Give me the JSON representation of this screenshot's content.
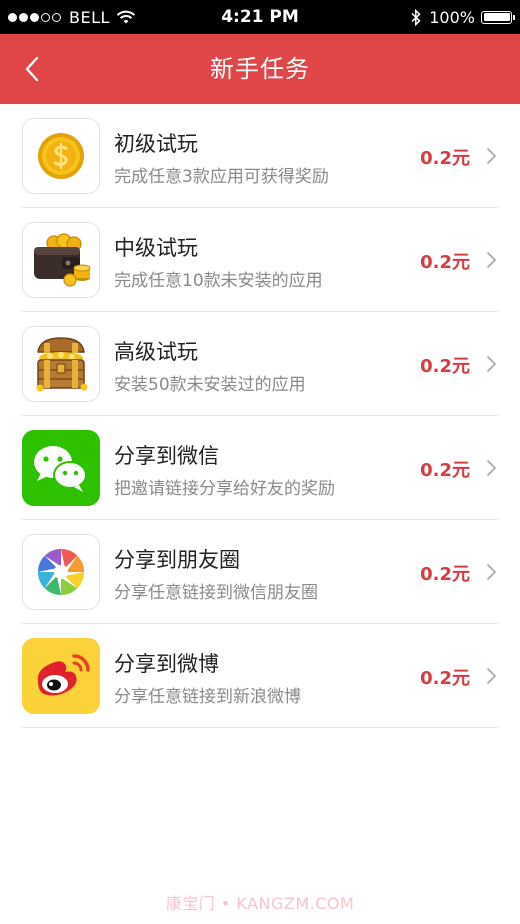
{
  "status_bar": {
    "carrier": "BELL",
    "time": "4:21 PM",
    "battery": "100%",
    "signal_icon": "signal-dots-icon",
    "wifi_icon": "wifi-icon",
    "bluetooth_icon": "bluetooth-icon",
    "battery_icon": "battery-icon"
  },
  "nav": {
    "title": "新手任务",
    "back_icon": "chevron-left-icon",
    "color": "#e04548"
  },
  "tasks": [
    {
      "title": "初级试玩",
      "desc": "完成任意3款应用可获得奖励",
      "reward": "0.2元",
      "icon": "gold-coin-icon"
    },
    {
      "title": "中级试玩",
      "desc": "完成任意10款未安装的应用",
      "reward": "0.2元",
      "icon": "wallet-coins-icon"
    },
    {
      "title": "高级试玩",
      "desc": "安装50款未安装过的应用",
      "reward": "0.2元",
      "icon": "treasure-chest-icon"
    },
    {
      "title": "分享到微信",
      "desc": "把邀请链接分享给好友的奖励",
      "reward": "0.2元",
      "icon": "wechat-icon"
    },
    {
      "title": "分享到朋友圈",
      "desc": "分享任意链接到微信朋友圈",
      "reward": "0.2元",
      "icon": "moments-icon"
    },
    {
      "title": "分享到微博",
      "desc": "分享任意链接到新浪微博",
      "reward": "0.2元",
      "icon": "weibo-icon"
    }
  ],
  "colors": {
    "accent": "#e04548",
    "reward": "#d73b3e"
  },
  "watermark": "康宝门 • KANGZM.COM"
}
